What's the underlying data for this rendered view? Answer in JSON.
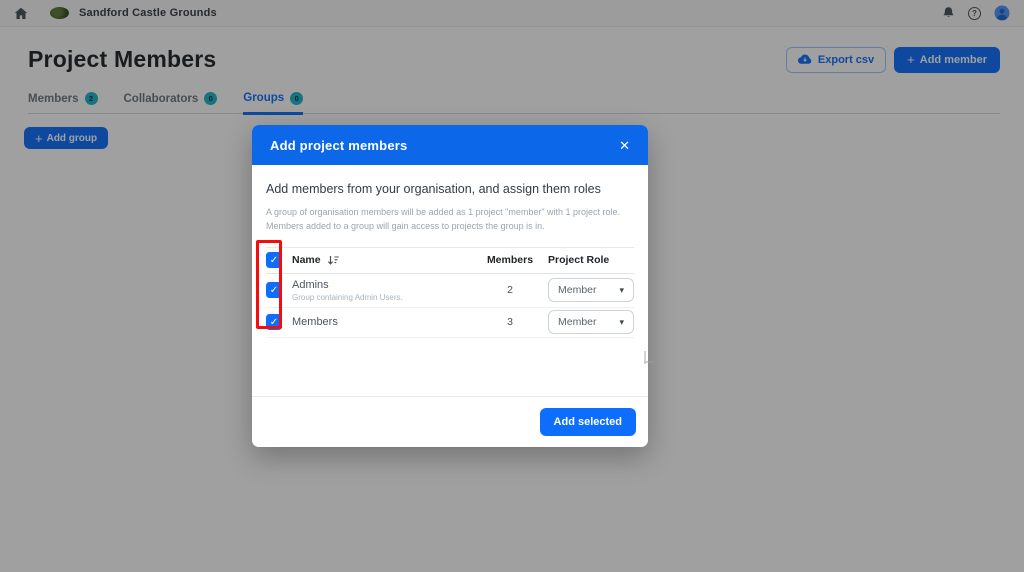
{
  "navbar": {
    "brand": "Sandford Castle Grounds"
  },
  "page": {
    "title": "Project Members",
    "buttons": {
      "export_csv": "Export csv",
      "add_member": "Add member",
      "add_group": "Add group",
      "add_selected": "Add selected"
    },
    "tabs": [
      {
        "label": "Members",
        "count": "2"
      },
      {
        "label": "Collaborators",
        "count": "0"
      },
      {
        "label": "Groups",
        "count": "0",
        "active": true
      }
    ]
  },
  "modal": {
    "title": "Add project members",
    "lead": "Add members from your organisation, and assign them roles",
    "description": "A group of organisation members will be added as 1 project \"member\" with 1 project role. Members added to a group will gain access to projects the group is in.",
    "table": {
      "headers": {
        "name": "Name",
        "members": "Members",
        "role": "Project Role"
      },
      "rows": [
        {
          "name": "Admins",
          "subtext": "Group containing Admin Users.",
          "members": "2",
          "role": "Member",
          "checked": true
        },
        {
          "name": "Members",
          "subtext": "",
          "members": "3",
          "role": "Member",
          "checked": true
        }
      ]
    }
  },
  "icons": {
    "check": "✓",
    "caret_down": "▾",
    "close": "✕",
    "help": "?",
    "plus": "+"
  },
  "colors": {
    "primary": "#0d6efd",
    "modal_header": "#0c68e8",
    "badge_bg": "#1cb5c9",
    "annotation_red": "#f50d0d",
    "navbar_bg": "#f8f9fa"
  }
}
